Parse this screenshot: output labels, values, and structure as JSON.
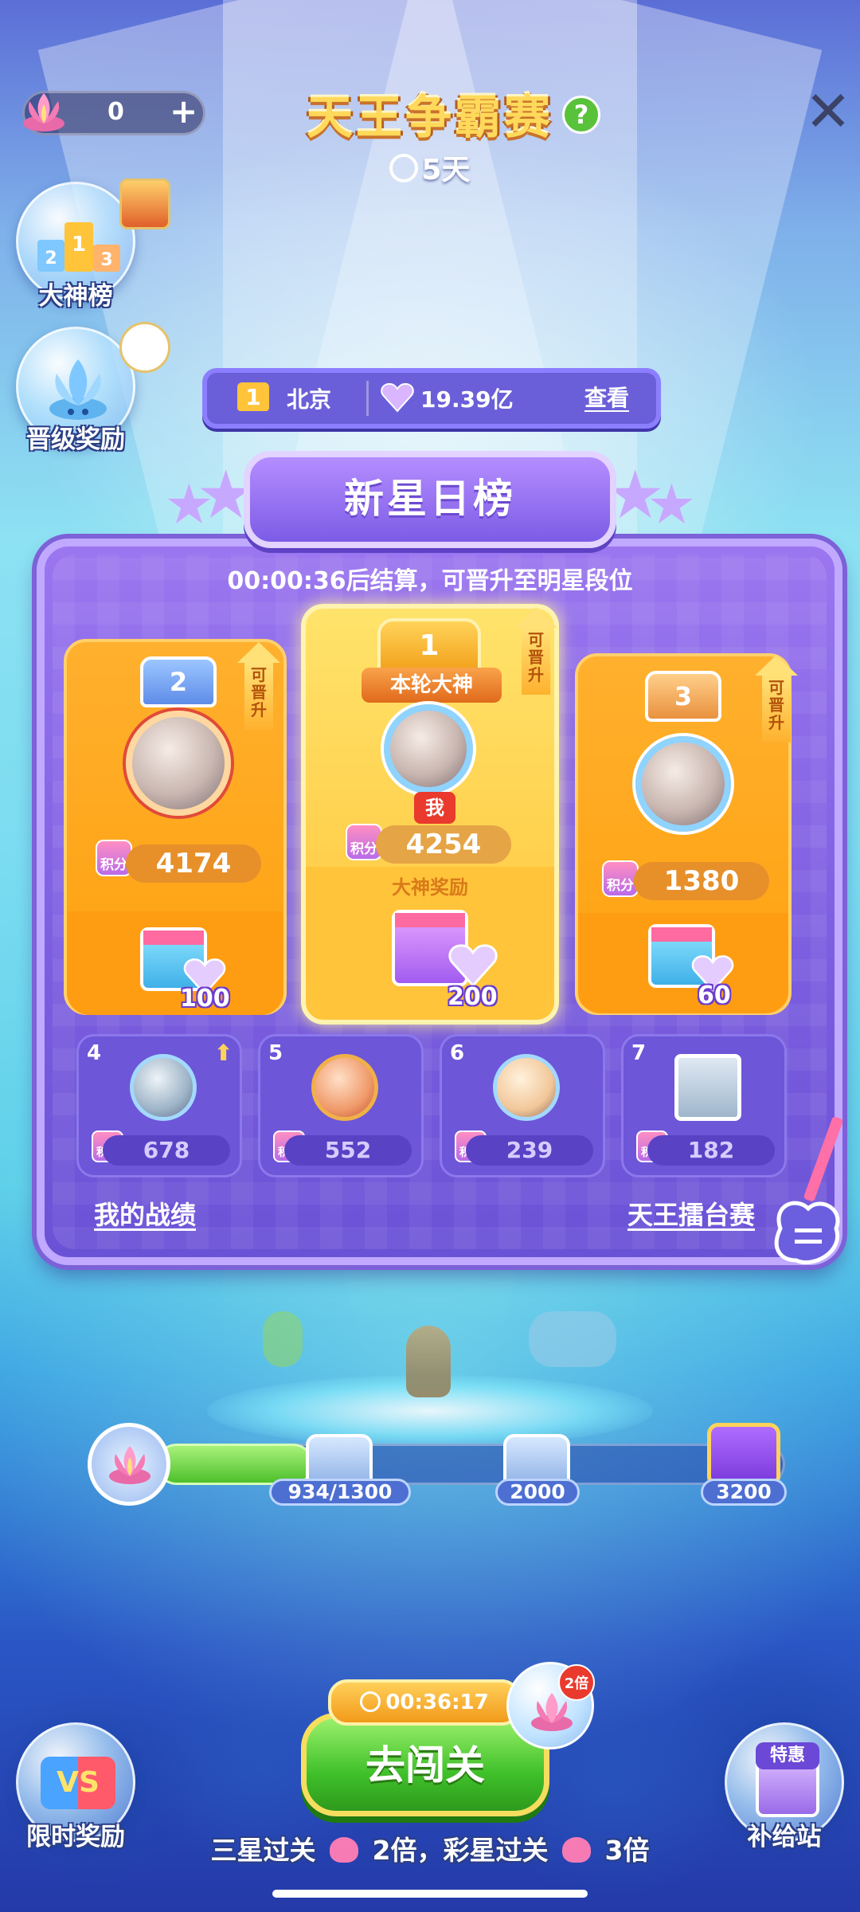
{
  "header": {
    "currency_value": "0",
    "currency_plus": "+",
    "title": "天王争霸赛",
    "help": "?",
    "timer": "5天",
    "close": "✕"
  },
  "side_left": {
    "leaderboard_label": "大神榜",
    "promotion_label": "晋级奖励",
    "limited_label": "限时奖励"
  },
  "side_right": {
    "supply_label": "补给站",
    "supply_tag": "特惠"
  },
  "infobar": {
    "rank": "1",
    "city": "北京",
    "hearts": "19.39亿",
    "view": "查看"
  },
  "board": {
    "title": "新星日榜",
    "countdown": "00:00:36后结算，可晋升至明星段位",
    "podium": [
      {
        "rank": "2",
        "score": "4174",
        "reward": "100",
        "promo": "可晋升"
      },
      {
        "rank": "1",
        "badge": "本轮大神",
        "me": "我",
        "score": "4254",
        "reward_label": "大神奖励",
        "reward": "200",
        "promo": "可晋升"
      },
      {
        "rank": "3",
        "score": "1380",
        "reward": "60",
        "promo": "可晋升"
      }
    ],
    "score_tag": "积分",
    "others": [
      {
        "rank": "4",
        "score": "678"
      },
      {
        "rank": "5",
        "score": "552"
      },
      {
        "rank": "6",
        "score": "239"
      },
      {
        "rank": "7",
        "score": "182"
      }
    ],
    "my_record": "我的战绩",
    "arena": "天王擂台赛"
  },
  "progress": {
    "current": 934,
    "milestones": [
      "934/1300",
      "2000",
      "3200"
    ],
    "fill_fraction": 0.2
  },
  "bottom": {
    "go_timer": "00:36:17",
    "go_label": "去闯关",
    "bonus_mult": "2倍",
    "tip_part1": "三星过关",
    "tip_part2": "2倍，彩星过关",
    "tip_part3": "3倍"
  },
  "colors": {
    "title_gold": "#ffd95a",
    "board_purple": "#7b5ddf",
    "go_green": "#3fc02a"
  }
}
